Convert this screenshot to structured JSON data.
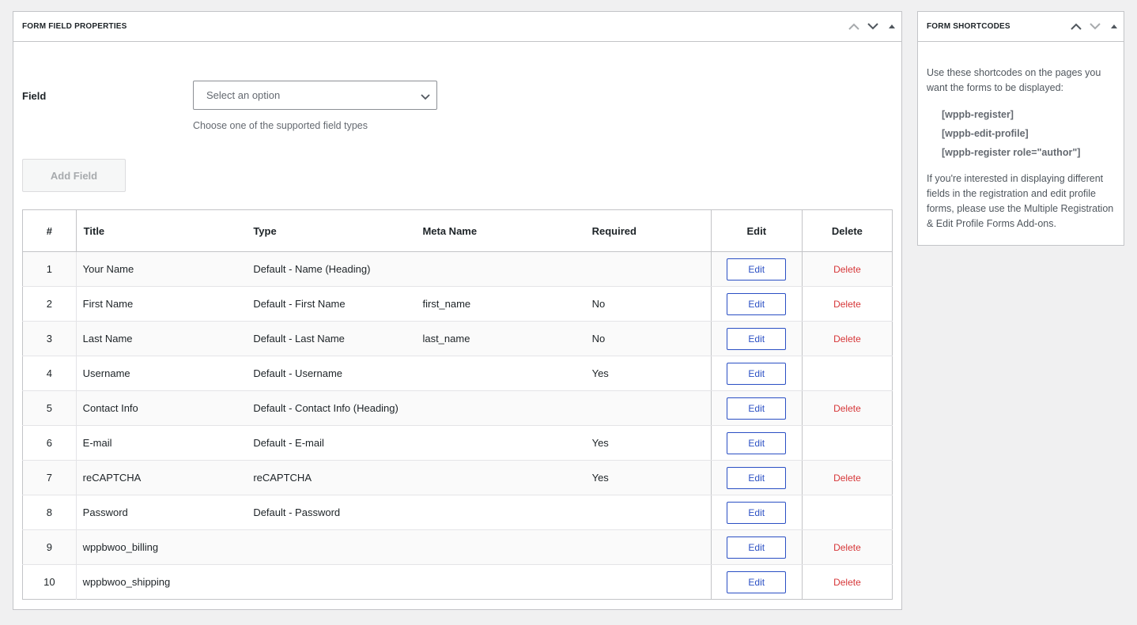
{
  "main_panel": {
    "title": "FORM FIELD PROPERTIES",
    "field_label": "Field",
    "select_placeholder": "Select an option",
    "field_description": "Choose one of the supported field types",
    "add_button": "Add Field",
    "table": {
      "headers": {
        "num": "#",
        "title": "Title",
        "type": "Type",
        "meta": "Meta Name",
        "required": "Required",
        "edit": "Edit",
        "delete": "Delete"
      },
      "rows": [
        {
          "num": "1",
          "title": "Your Name",
          "type": "Default - Name (Heading)",
          "meta": "",
          "required": "",
          "edit": "Edit",
          "delete": "Delete"
        },
        {
          "num": "2",
          "title": "First Name",
          "type": "Default - First Name",
          "meta": "first_name",
          "required": "No",
          "edit": "Edit",
          "delete": "Delete"
        },
        {
          "num": "3",
          "title": "Last Name",
          "type": "Default - Last Name",
          "meta": "last_name",
          "required": "No",
          "edit": "Edit",
          "delete": "Delete"
        },
        {
          "num": "4",
          "title": "Username",
          "type": "Default - Username",
          "meta": "",
          "required": "Yes",
          "edit": "Edit",
          "delete": ""
        },
        {
          "num": "5",
          "title": "Contact Info",
          "type": "Default - Contact Info (Heading)",
          "meta": "",
          "required": "",
          "edit": "Edit",
          "delete": "Delete"
        },
        {
          "num": "6",
          "title": "E-mail",
          "type": "Default - E-mail",
          "meta": "",
          "required": "Yes",
          "edit": "Edit",
          "delete": ""
        },
        {
          "num": "7",
          "title": "reCAPTCHA",
          "type": "reCAPTCHA",
          "meta": "",
          "required": "Yes",
          "edit": "Edit",
          "delete": "Delete"
        },
        {
          "num": "8",
          "title": "Password",
          "type": "Default - Password",
          "meta": "",
          "required": "",
          "edit": "Edit",
          "delete": ""
        },
        {
          "num": "9",
          "title": "wppbwoo_billing",
          "type": "",
          "meta": "",
          "required": "",
          "edit": "Edit",
          "delete": "Delete"
        },
        {
          "num": "10",
          "title": "wppbwoo_shipping",
          "type": "",
          "meta": "",
          "required": "",
          "edit": "Edit",
          "delete": "Delete"
        }
      ]
    }
  },
  "side_panel": {
    "title": "FORM SHORTCODES",
    "intro": "Use these shortcodes on the pages you want the forms to be displayed:",
    "shortcodes": [
      "[wppb-register]",
      "[wppb-edit-profile]",
      "[wppb-register role=\"author\"]"
    ],
    "note": "If you're interested in displaying different fields in the registration and edit profile forms, please use the Multiple Registration & Edit Profile Forms Add-ons."
  },
  "icons": {
    "move_up": "chevron-up-icon",
    "move_down": "chevron-down-icon",
    "toggle": "triangle-up-icon",
    "select_arrow": "chevron-down-icon"
  },
  "colors": {
    "accent": "#2a4fc4",
    "danger": "#d63638",
    "border": "#c3c4c7",
    "background": "#f0f0f1"
  }
}
